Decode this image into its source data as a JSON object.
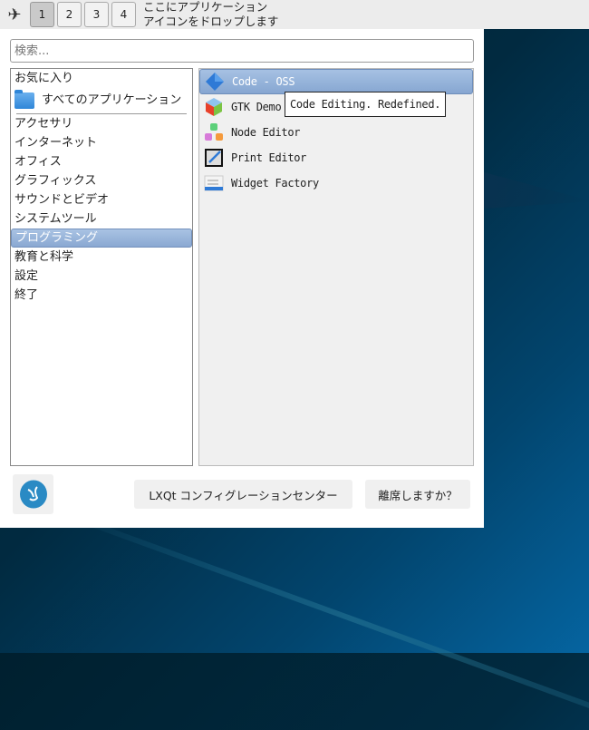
{
  "panel": {
    "desktops": [
      "1",
      "2",
      "3",
      "4"
    ],
    "active_desktop": "1",
    "quicklaunch_hint_line1": "ここにアプリケーション",
    "quicklaunch_hint_line2": "アイコンをドロップします"
  },
  "menu": {
    "search": {
      "placeholder": "検索..."
    },
    "favorites": "お気に入り",
    "all_apps": "すべてのアプリケーション",
    "categories": [
      "アクセサリ",
      "インターネット",
      "オフィス",
      "グラフィックス",
      "サウンドとビデオ",
      "システムツール",
      "プログラミング",
      "教育と科学",
      "設定",
      "終了"
    ],
    "selected_category": "プログラミング",
    "apps": [
      "Code - OSS",
      "GTK Demo",
      "Node Editor",
      "Print Editor",
      "Widget Factory"
    ],
    "tooltip": "Code Editing. Redefined.",
    "config_button": "LXQt コンフィグレーションセンター",
    "leave_button": "離席しますか？"
  },
  "colors": {
    "selection": "#8aa8d2",
    "user_icon": "#2a8ac4"
  }
}
